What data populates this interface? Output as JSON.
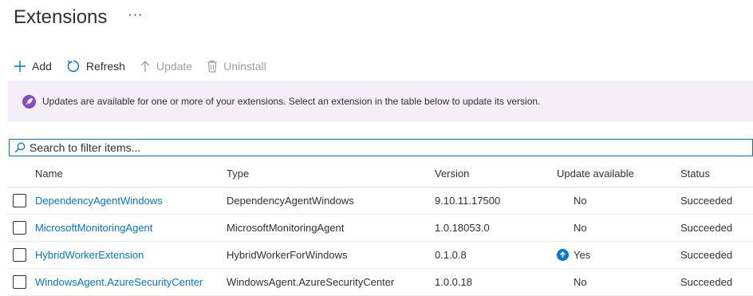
{
  "page": {
    "title": "Extensions",
    "more_label": "···"
  },
  "toolbar": {
    "add_label": "Add",
    "refresh_label": "Refresh",
    "update_label": "Update",
    "uninstall_label": "Uninstall"
  },
  "banner": {
    "icon": "rocket-icon",
    "text": "Updates are available for one or more of your extensions. Select an extension in the table below to update its version."
  },
  "search": {
    "placeholder": "Search to filter items..."
  },
  "table": {
    "columns": [
      "Name",
      "Type",
      "Version",
      "Update available",
      "Status"
    ],
    "rows": [
      {
        "name": "DependencyAgentWindows",
        "type": "DependencyAgentWindows",
        "version": "9.10.11.17500",
        "update": "No",
        "status": "Succeeded"
      },
      {
        "name": "MicrosoftMonitoringAgent",
        "type": "MicrosoftMonitoringAgent",
        "version": "1.0.18053.0",
        "update": "No",
        "status": "Succeeded"
      },
      {
        "name": "HybridWorkerExtension",
        "type": "HybridWorkerForWindows",
        "version": "0.1.0.8",
        "update": "Yes",
        "status": "Succeeded"
      },
      {
        "name": "WindowsAgent.AzureSecurityCenter",
        "type": "WindowsAgent.AzureSecurityCenter",
        "version": "1.0.0.18",
        "update": "No",
        "status": "Succeeded"
      }
    ]
  },
  "colors": {
    "accent": "#0078d4",
    "banner_bg": "#f3eef8",
    "banner_icon": "#8a4bbd",
    "disabled_text": "#a19f9d"
  }
}
